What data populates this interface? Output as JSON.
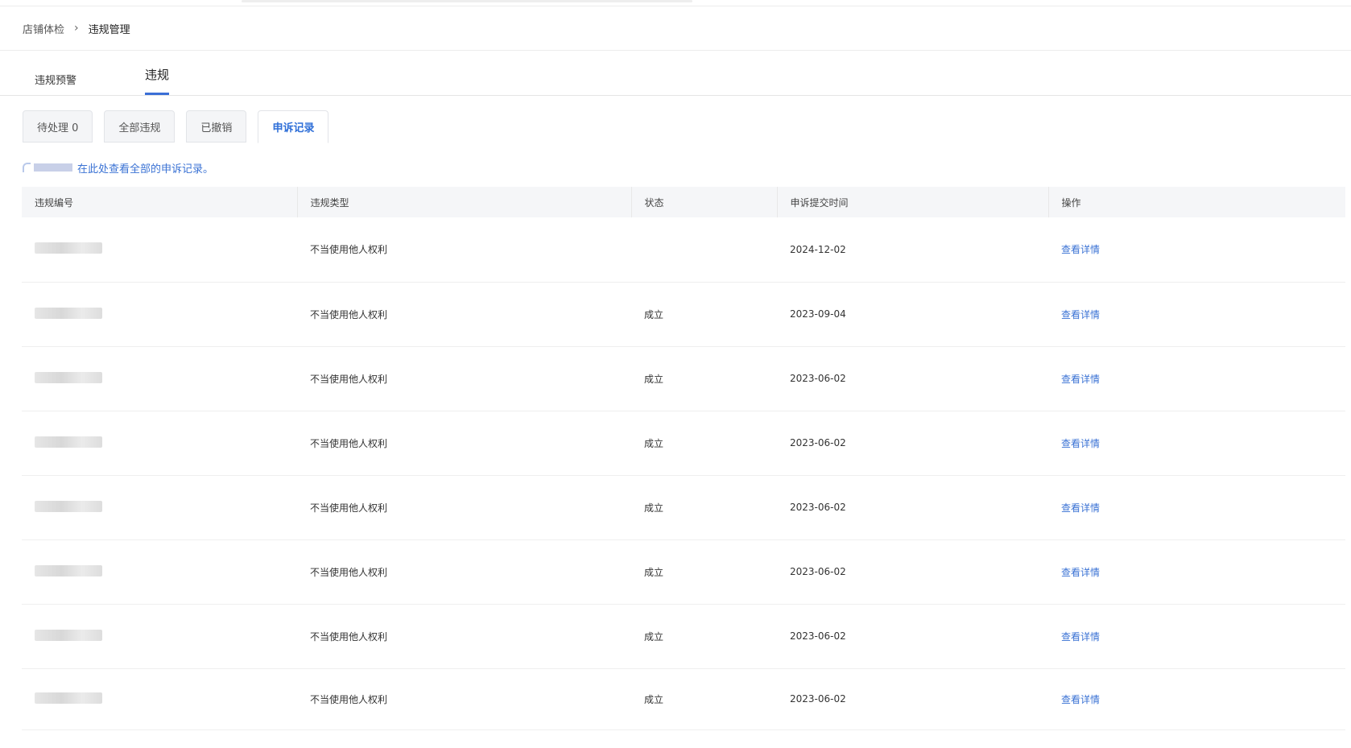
{
  "breadcrumb": {
    "items": [
      "店铺体检",
      "违规管理"
    ]
  },
  "tabs": [
    {
      "label": "违规预警",
      "active": false
    },
    {
      "label": "违规",
      "active": true
    }
  ],
  "subtabs": [
    {
      "label": "待处理 0",
      "active": false
    },
    {
      "label": "全部违规",
      "active": false
    },
    {
      "label": "已撤销",
      "active": false
    },
    {
      "label": "申诉记录",
      "active": true
    }
  ],
  "notice": {
    "link_text": "在此处查看全部的申诉记录。"
  },
  "table": {
    "headers": [
      "违规编号",
      "违规类型",
      "状态",
      "申诉提交时间",
      "操作"
    ],
    "rows": [
      {
        "type": "不当使用他人权利",
        "status": "",
        "time": "2024-12-02",
        "action": "查看详情"
      },
      {
        "type": "不当使用他人权利",
        "status": "成立",
        "time": "2023-09-04",
        "action": "查看详情"
      },
      {
        "type": "不当使用他人权利",
        "status": "成立",
        "time": "2023-06-02",
        "action": "查看详情"
      },
      {
        "type": "不当使用他人权利",
        "status": "成立",
        "time": "2023-06-02",
        "action": "查看详情"
      },
      {
        "type": "不当使用他人权利",
        "status": "成立",
        "time": "2023-06-02",
        "action": "查看详情"
      },
      {
        "type": "不当使用他人权利",
        "status": "成立",
        "time": "2023-06-02",
        "action": "查看详情"
      },
      {
        "type": "不当使用他人权利",
        "status": "成立",
        "time": "2023-06-02",
        "action": "查看详情"
      },
      {
        "type": "不当使用他人权利",
        "status": "成立",
        "time": "2023-06-02",
        "action": "查看详情"
      }
    ]
  },
  "colors": {
    "accent": "#3a72d4",
    "tab_underline": "#3b6fd6"
  }
}
